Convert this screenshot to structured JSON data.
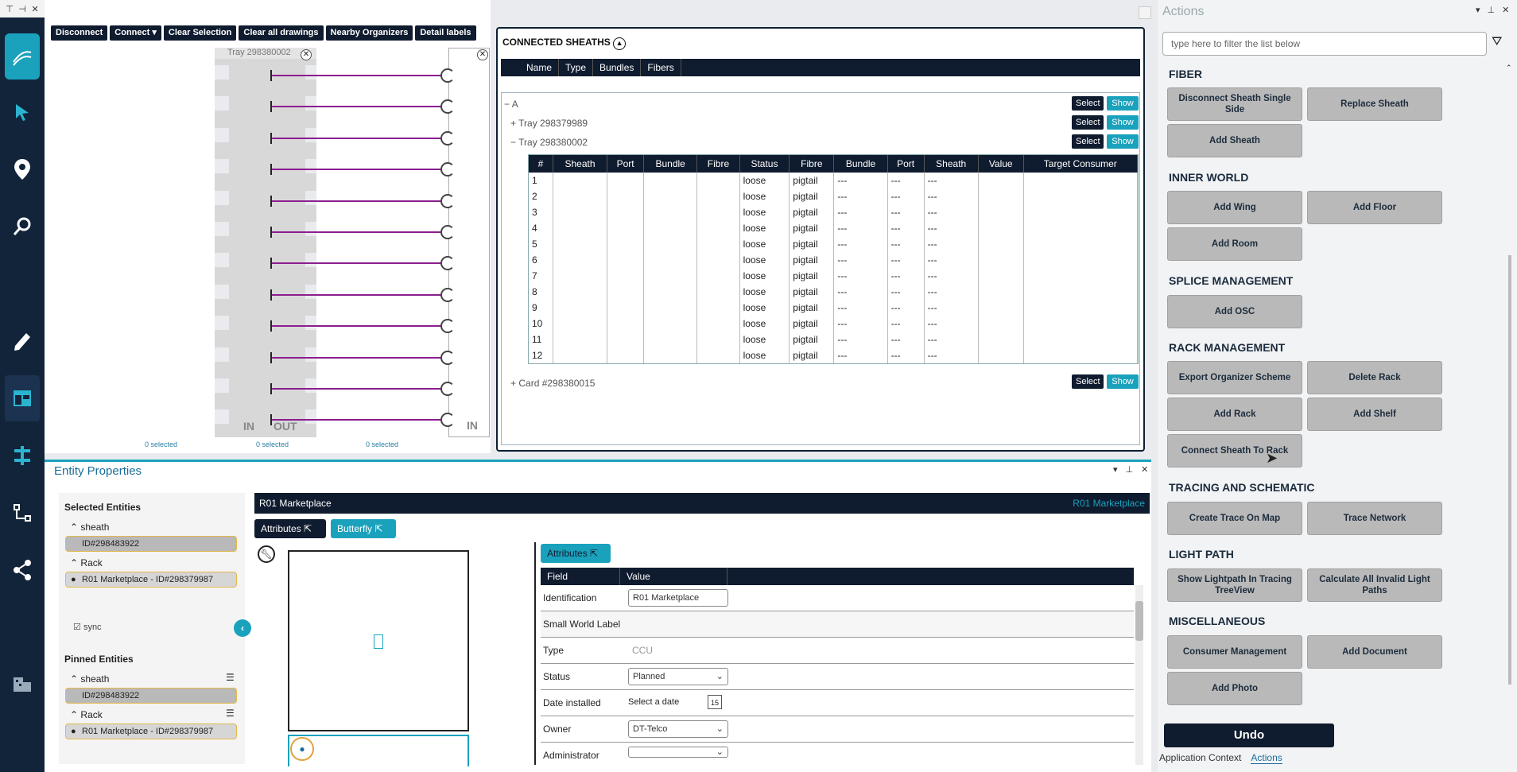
{
  "toolbar": {
    "disconnect": "Disconnect",
    "connect": "Connect",
    "clear_selection": "Clear Selection",
    "clear_drawings": "Clear all drawings",
    "nearby": "Nearby Organizers",
    "detail_labels": "Detail labels"
  },
  "tray": {
    "label": "Tray 298380002",
    "in": "IN",
    "out": "OUT",
    "in2": "IN",
    "sel1": "0 selected",
    "sel2": "0 selected",
    "sel3": "0 selected"
  },
  "sheaths": {
    "title": "CONNECTED SHEATHS",
    "cols": [
      "Name",
      "Type",
      "Bundles",
      "Fibers"
    ],
    "tree": {
      "root": "A",
      "t1": "Tray 298379989",
      "t2": "Tray 298380002",
      "card": "Card #298380015",
      "select": "Select",
      "show": "Show"
    },
    "fiber_cols": [
      "#",
      "Sheath",
      "Port",
      "Bundle",
      "Fibre",
      "Status",
      "Fibre",
      "Bundle",
      "Port",
      "Sheath",
      "Value",
      "Target Consumer"
    ],
    "fiber_rows": [
      [
        "1",
        "loose",
        "pigtail",
        "---",
        "---",
        "---"
      ],
      [
        "2",
        "loose",
        "pigtail",
        "---",
        "---",
        "---"
      ],
      [
        "3",
        "loose",
        "pigtail",
        "---",
        "---",
        "---"
      ],
      [
        "4",
        "loose",
        "pigtail",
        "---",
        "---",
        "---"
      ],
      [
        "5",
        "loose",
        "pigtail",
        "---",
        "---",
        "---"
      ],
      [
        "6",
        "loose",
        "pigtail",
        "---",
        "---",
        "---"
      ],
      [
        "7",
        "loose",
        "pigtail",
        "---",
        "---",
        "---"
      ],
      [
        "8",
        "loose",
        "pigtail",
        "---",
        "---",
        "---"
      ],
      [
        "9",
        "loose",
        "pigtail",
        "---",
        "---",
        "---"
      ],
      [
        "10",
        "loose",
        "pigtail",
        "---",
        "---",
        "---"
      ],
      [
        "11",
        "loose",
        "pigtail",
        "---",
        "---",
        "---"
      ],
      [
        "12",
        "loose",
        "pigtail",
        "---",
        "---",
        "---"
      ]
    ]
  },
  "props": {
    "title": "Entity Properties",
    "selected_entities": "Selected Entities",
    "sheath": "sheath",
    "sheath_id": "ID#298483922",
    "rack": "Rack",
    "rack_id": "R01 Marketplace - ID#298379987",
    "sync": "sync",
    "pinned": "Pinned Entities",
    "pin_sheath": "sheath",
    "pin_sheath_id": "ID#298483922",
    "pin_rack": "Rack",
    "pin_rack_id": "R01 Marketplace - ID#298379987",
    "bar_title": "R01 Marketplace",
    "bar_right": "R01 Marketplace",
    "tab_attributes": "Attributes",
    "tab_butterfly": "Butterfly",
    "sub_attributes": "Attributes",
    "field_hdr": "Field",
    "value_hdr": "Value",
    "rows": {
      "ident_f": "Identification",
      "ident_v": "R01 Marketplace",
      "swl_f": "Small World Label",
      "type_f": "Type",
      "type_v": "CCU",
      "status_f": "Status",
      "status_v": "Planned",
      "date_f": "Date installed",
      "date_v": "Select a date",
      "date_icon": "15",
      "owner_f": "Owner",
      "owner_v": "DT-Telco",
      "admin_f": "Administrator"
    }
  },
  "actions": {
    "title": "Actions",
    "filter_placeholder": "type here to filter the list below",
    "fiber": "FIBER",
    "disconnect_single": "Disconnect Sheath Single Side",
    "replace_sheath": "Replace Sheath",
    "add_sheath": "Add Sheath",
    "inner": "INNER WORLD",
    "add_wing": "Add Wing",
    "add_floor": "Add Floor",
    "add_room": "Add Room",
    "splice": "SPLICE MANAGEMENT",
    "add_osc": "Add OSC",
    "rack": "RACK MANAGEMENT",
    "export_org": "Export Organizer Scheme",
    "delete_rack": "Delete Rack",
    "add_rack": "Add Rack",
    "add_shelf": "Add Shelf",
    "connect_sheath_rack": "Connect Sheath To Rack",
    "tracing": "TRACING AND SCHEMATIC",
    "create_trace": "Create Trace On Map",
    "trace_network": "Trace Network",
    "lightpath": "LIGHT PATH",
    "show_lightpath": "Show Lightpath In Tracing TreeView",
    "calc_invalid": "Calculate All Invalid Light Paths",
    "misc": "MISCELLANEOUS",
    "consumer_mgmt": "Consumer Management",
    "add_document": "Add Document",
    "add_photo": "Add Photo",
    "undo": "Undo",
    "tab_app": "Application Context",
    "tab_actions": "Actions"
  },
  "colors": {
    "accent": "#1aa2bd",
    "dark": "#0f1b2e",
    "fiber": "#8b1e8f"
  }
}
